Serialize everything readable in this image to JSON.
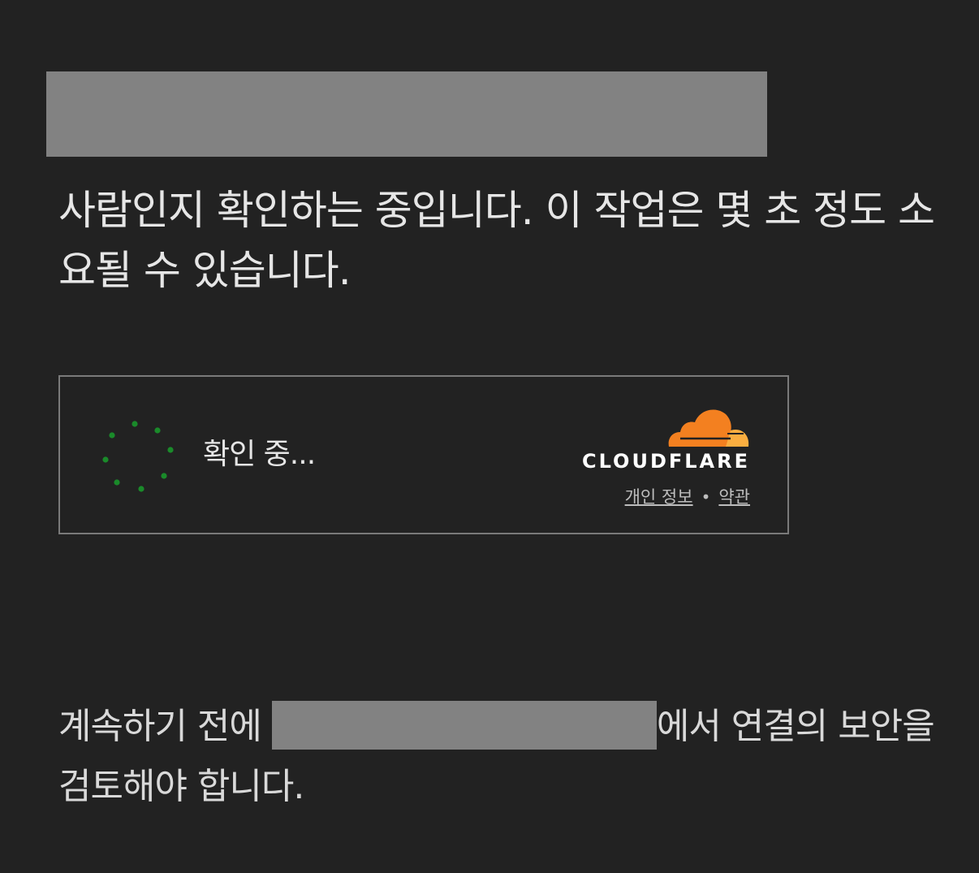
{
  "heading": "사람인지 확인하는 중입니다. 이 작업은 몇 초 정도 소요될 수 있습니다.",
  "widget": {
    "status_text": "확인 중...",
    "brand_name": "CLOUDFLARE",
    "privacy_link": "개인 정보",
    "terms_link": "약관",
    "separator": "•",
    "spinner_color": "#1a8a2a",
    "logo_colors": {
      "primary": "#f38020",
      "secondary": "#faae40"
    },
    "spinner_icon": "loading-spinner-icon",
    "logo_icon": "cloudflare-cloud-icon"
  },
  "footer": {
    "before": "계속하기 전에 ",
    "after": "에서 연결의 보안을 검토해야 합니다."
  },
  "colors": {
    "background": "#222222",
    "redaction": "#828282"
  }
}
